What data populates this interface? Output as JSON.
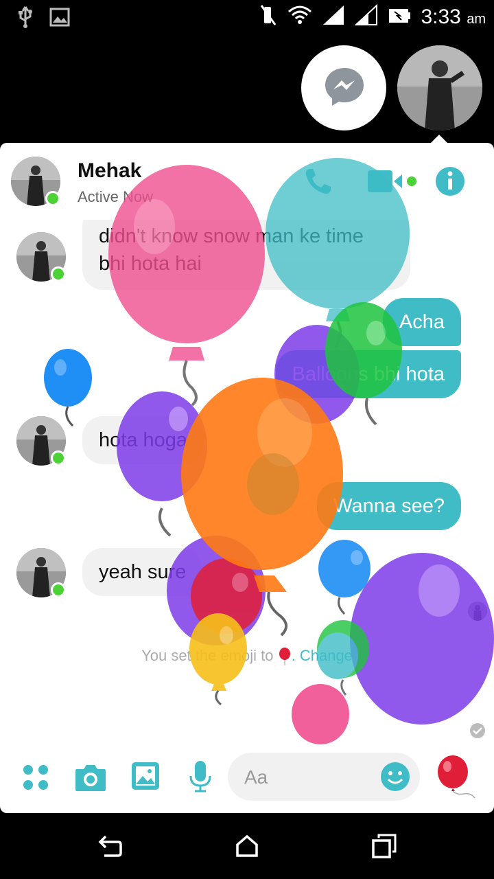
{
  "status_bar": {
    "time": "3:33",
    "ampm": "am",
    "icons": [
      "usb-icon",
      "image-icon",
      "mute-icon",
      "wifi-icon",
      "signal-icon",
      "signal-icon",
      "battery-icon"
    ]
  },
  "header": {
    "contact_name": "Mehak",
    "presence": "Active Now",
    "icons": [
      "phone-icon",
      "video-icon",
      "info-icon"
    ]
  },
  "messages": [
    {
      "from": "them",
      "text_lines": [
        "didn't know snow man ke time",
        "bhi hota hai"
      ]
    },
    {
      "from": "me",
      "text": "Acha"
    },
    {
      "from": "me",
      "text": "Balloons bhi hota"
    },
    {
      "from": "them",
      "text": "hota hoga"
    },
    {
      "from": "me",
      "text": "Wanna see?"
    },
    {
      "from": "them",
      "text": "yeah sure"
    }
  ],
  "notice": {
    "prefix": "You set the emoji to ",
    "suffix": ". Change"
  },
  "composer": {
    "placeholder": "Aa",
    "icons": [
      "apps-icon",
      "camera-icon",
      "gallery-icon",
      "microphone-icon",
      "emoji-icon",
      "balloon-icon"
    ]
  },
  "navbar": {
    "icons": [
      "back-icon",
      "home-icon",
      "recents-icon"
    ]
  },
  "colors": {
    "accent": "#3fbcc6",
    "online": "#4cd137",
    "background": "#000000"
  }
}
